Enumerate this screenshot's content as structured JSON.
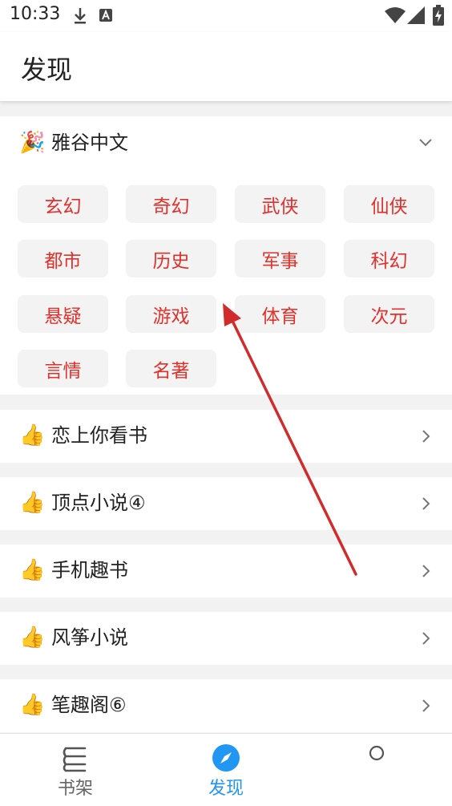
{
  "status_bar": {
    "time": "10:33"
  },
  "header": {
    "title": "发现"
  },
  "featured": {
    "icon": "party-popper-icon",
    "label": "雅谷中文",
    "tags": [
      "玄幻",
      "奇幻",
      "武侠",
      "仙侠",
      "都市",
      "历史",
      "军事",
      "科幻",
      "悬疑",
      "游戏",
      "体育",
      "次元",
      "言情",
      "名著"
    ]
  },
  "sources": [
    {
      "icon": "thumbs-up-icon",
      "label": "恋上你看书"
    },
    {
      "icon": "thumbs-up-icon",
      "label": "顶点小说④"
    },
    {
      "icon": "thumbs-up-icon",
      "label": "手机趣书"
    },
    {
      "icon": "thumbs-up-icon",
      "label": "风筝小说"
    },
    {
      "icon": "thumbs-up-icon",
      "label": "笔趣阁⑥"
    }
  ],
  "bottom_nav": {
    "items": [
      {
        "label": "书架",
        "icon": "bookshelf-icon"
      },
      {
        "label": "发现",
        "icon": "compass-icon"
      },
      {
        "label": "",
        "icon": "circle-icon"
      }
    ],
    "active": "发现",
    "accent": "#2196f3"
  },
  "colors": {
    "tag_text": "#e0312d",
    "tag_bg": "#f3f3f3",
    "annotation_arrow": "#d22b2b"
  }
}
